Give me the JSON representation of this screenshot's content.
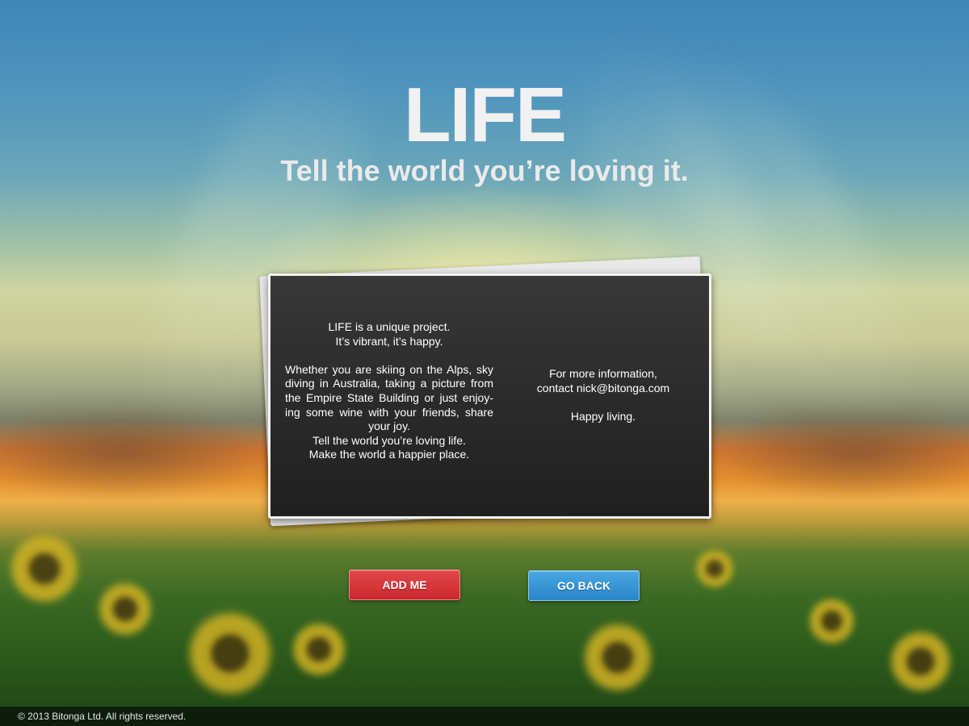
{
  "hero": {
    "title": "LIFE",
    "subtitle": "Tell the world you’re loving it."
  },
  "card": {
    "left_column": {
      "intro_line1": "LIFE is a unique project.",
      "intro_line2": "It’s vibrant, it’s happy.",
      "body": "Whether you are skiing on the Alps, sky diving in Australia, taking a picture from the Empire State Building or just enjoy-ing some wine with your friends, share your joy.",
      "closing_line1": "Tell the world you’re loving life.",
      "closing_line2": "Make the world a happier place."
    },
    "right_column": {
      "info_line1": "For more information,",
      "info_line2": "contact nick@bitonga.com",
      "signoff": "Happy living."
    }
  },
  "buttons": {
    "add_label": "ADD ME",
    "back_label": "GO BACK"
  },
  "footer": {
    "copyright": "© 2013 Bitonga Ltd. All rights reserved."
  },
  "colors": {
    "add_button": "#d3353a",
    "back_button": "#3a97d8",
    "card_background": "#2c2c2c",
    "card_border": "#f5f5f5"
  }
}
